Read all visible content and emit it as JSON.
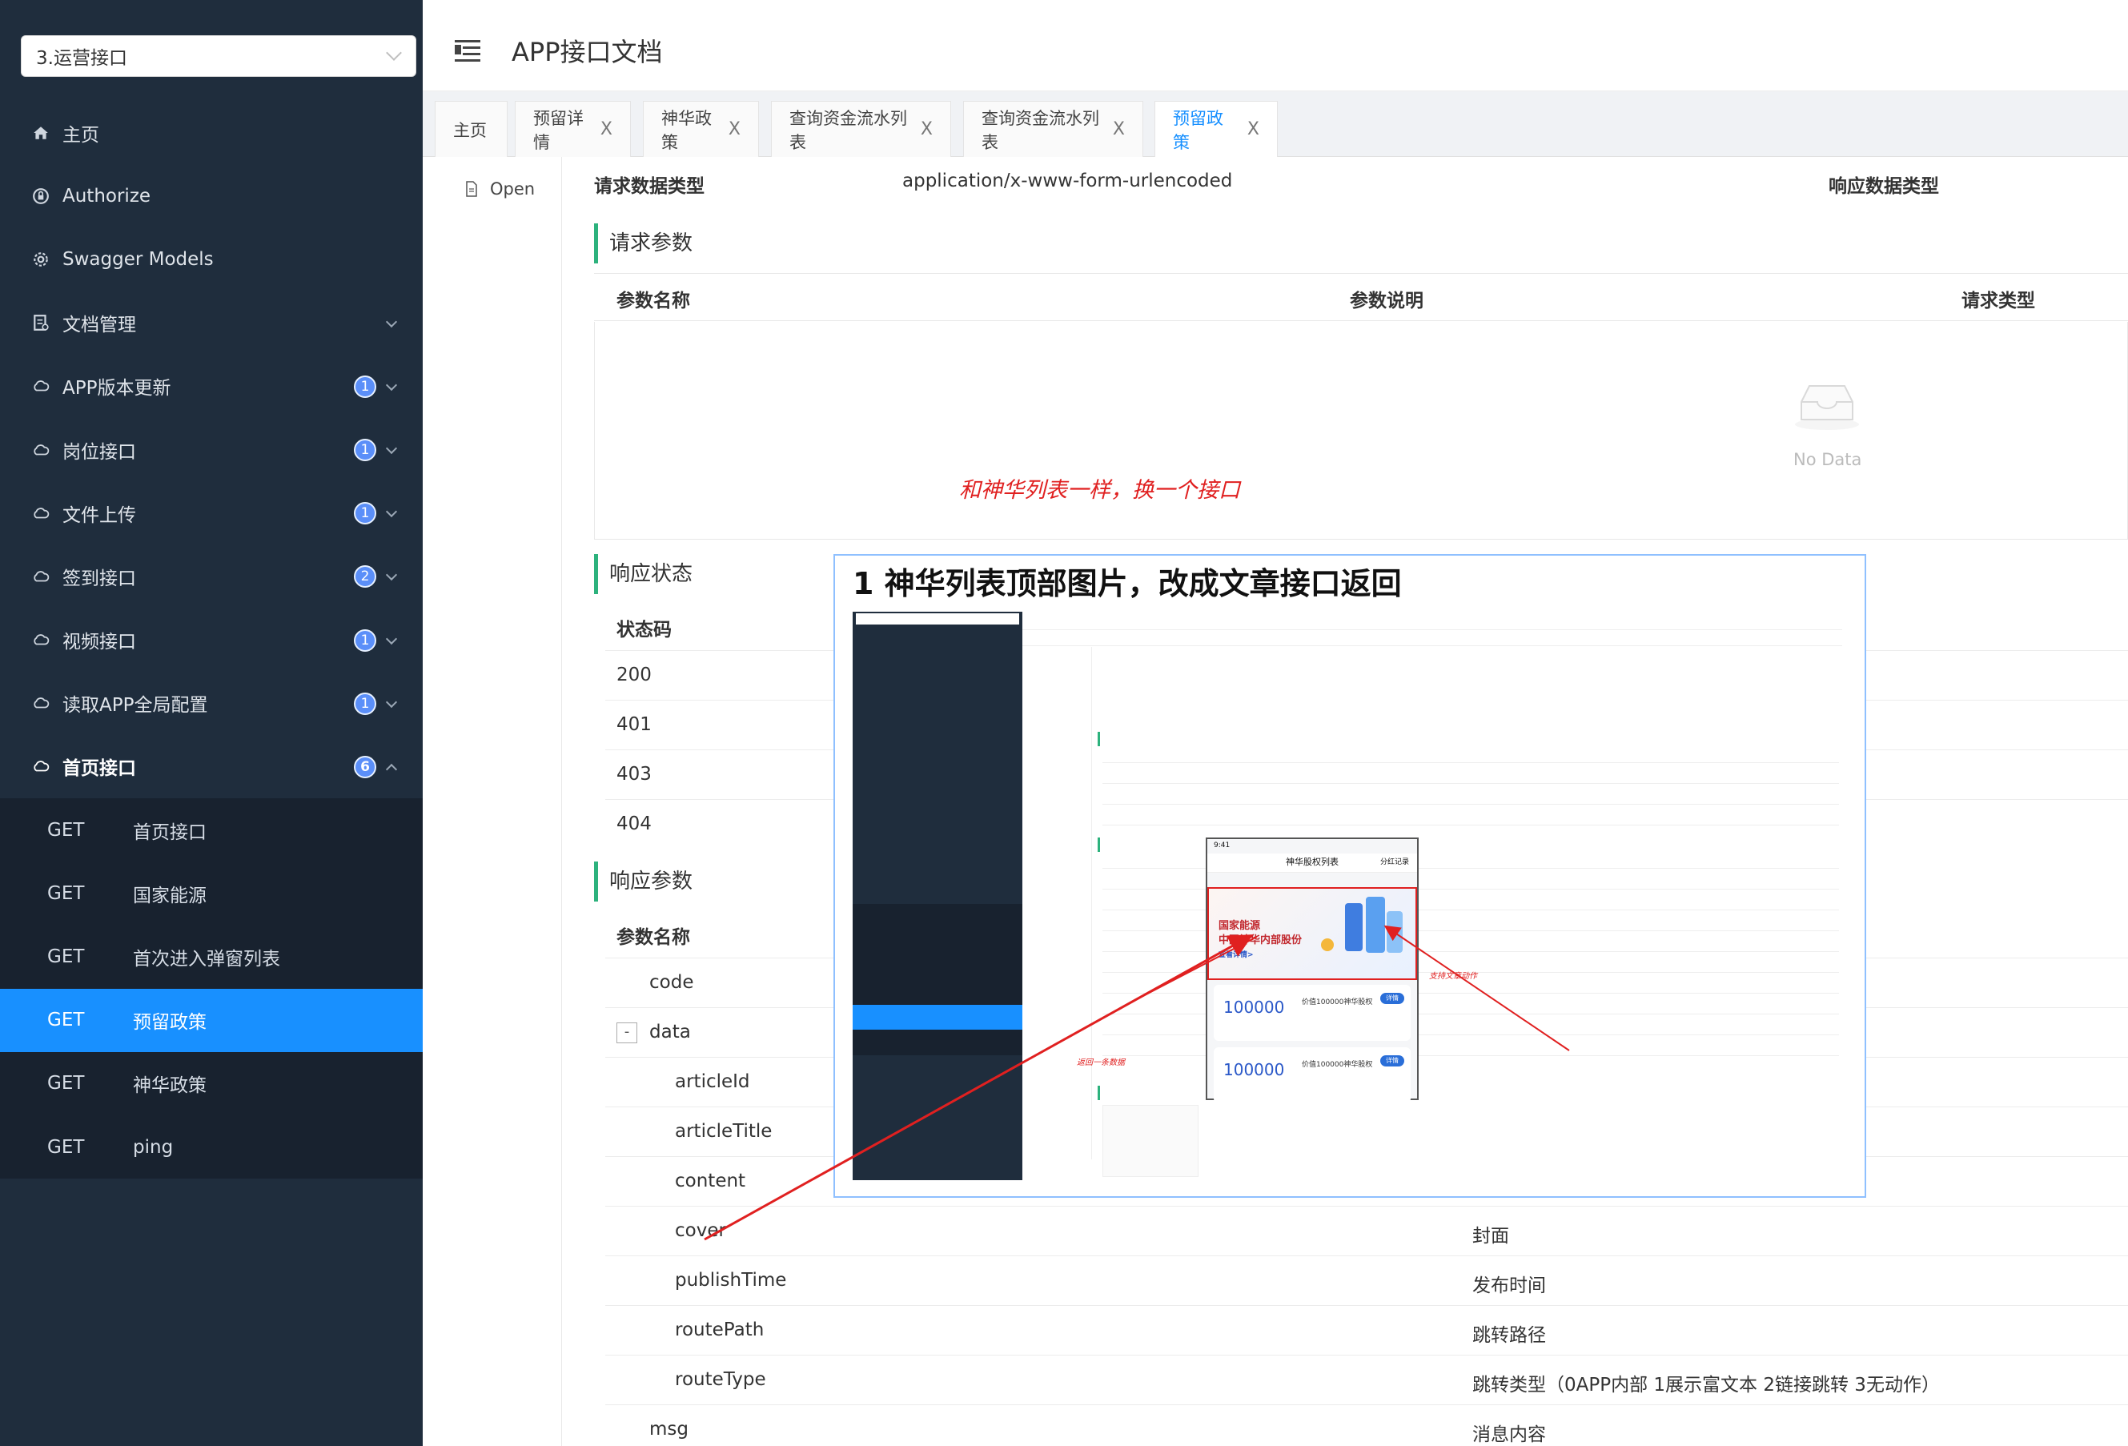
{
  "sidebar": {
    "selector": "3.运营接口",
    "items": [
      {
        "label": "主页",
        "icon": "home-icon"
      },
      {
        "label": "Authorize",
        "icon": "lock-icon"
      },
      {
        "label": "Swagger Models",
        "icon": "settings-icon"
      },
      {
        "label": "文档管理",
        "icon": "document-icon"
      },
      {
        "label": "APP版本更新",
        "icon": "cloud-icon",
        "badge": "1"
      },
      {
        "label": "岗位接口",
        "icon": "cloud-icon",
        "badge": "1"
      },
      {
        "label": "文件上传",
        "icon": "cloud-icon",
        "badge": "1"
      },
      {
        "label": "签到接口",
        "icon": "cloud-icon",
        "badge": "2"
      },
      {
        "label": "视频接口",
        "icon": "cloud-icon",
        "badge": "1"
      },
      {
        "label": "读取APP全局配置",
        "icon": "cloud-icon",
        "badge": "1"
      },
      {
        "label": "首页接口",
        "icon": "cloud-icon",
        "badge": "6"
      }
    ],
    "subitems": [
      {
        "method": "GET",
        "label": "首页接口"
      },
      {
        "method": "GET",
        "label": "国家能源"
      },
      {
        "method": "GET",
        "label": "首次进入弹窗列表"
      },
      {
        "method": "GET",
        "label": "预留政策"
      },
      {
        "method": "GET",
        "label": "神华政策"
      },
      {
        "method": "GET",
        "label": "ping"
      }
    ]
  },
  "header": {
    "title": "APP接口文档"
  },
  "tabs": [
    {
      "label": "主页"
    },
    {
      "label": "预留详情"
    },
    {
      "label": "神华政策"
    },
    {
      "label": "查询资金流水列表"
    },
    {
      "label": "查询资金流水列表"
    },
    {
      "label": "预留政策"
    }
  ],
  "tab_close": "X",
  "open_label": "Open",
  "request": {
    "content_type_label": "请求数据类型",
    "content_type_value": "application/x-www-form-urlencoded",
    "response_type_label": "响应数据类型",
    "params_title": "请求参数",
    "col_name": "参数名称",
    "col_desc": "参数说明",
    "col_type": "请求类型",
    "no_data": "No Data"
  },
  "annotation": "和神华列表一样，换一个接口",
  "status": {
    "title": "响应状态",
    "col_code": "状态码",
    "codes": [
      "200",
      "401",
      "403",
      "404"
    ]
  },
  "response": {
    "title": "响应参数",
    "col_name": "参数名称",
    "collapse": "-",
    "rows": [
      {
        "name": "code",
        "desc": ""
      },
      {
        "name": "data",
        "desc": ""
      },
      {
        "name": "articleId",
        "desc": ""
      },
      {
        "name": "articleTitle",
        "desc": ""
      },
      {
        "name": "content",
        "desc": ""
      },
      {
        "name": "cover",
        "desc": "封面"
      },
      {
        "name": "publishTime",
        "desc": "发布时间"
      },
      {
        "name": "routePath",
        "desc": "跳转路径"
      },
      {
        "name": "routeType",
        "desc": "跳转类型（0APP内部 1展示富文本 2链接跳转 3无动作）"
      },
      {
        "name": "msg",
        "desc": "消息内容"
      }
    ]
  },
  "overlay": {
    "title": "1 神华列表顶部图片，改成文章接口返回",
    "phone_title": "神华股权列表",
    "phone_right": "分红记录",
    "phone_time": "9:41",
    "banner_line1": "国家能源",
    "banner_line2": "中国神华内部股份",
    "banner_line3": "查看详情>",
    "card_amount": "100000",
    "card_desc": "价值100000神华股权",
    "card_btn": "详情",
    "note_left": "返回一条数据",
    "note_right": "支持文章动作"
  },
  "colors": {
    "sidebar_bg": "#1f2d3d",
    "accent": "#1890ff",
    "section_bar": "#2db27d",
    "annotation_red": "#e02020"
  }
}
